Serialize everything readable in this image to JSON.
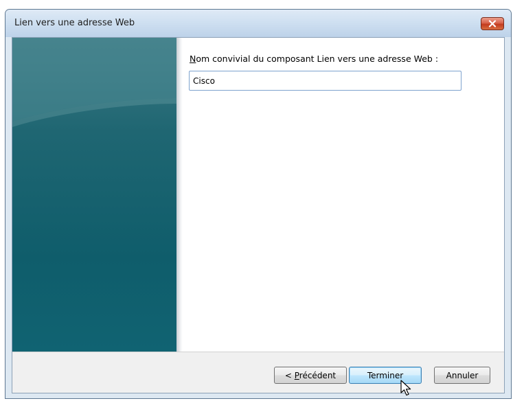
{
  "window": {
    "title": "Lien vers une adresse Web",
    "close_icon": "close-icon"
  },
  "form": {
    "label_mnemonic": "N",
    "label_rest": "om convivial du composant Lien vers une adresse Web :",
    "input_value": "Cisco"
  },
  "buttons": {
    "prev_prefix": "< ",
    "prev_mnemonic": "P",
    "prev_rest": "récédent",
    "finish": "Terminer",
    "cancel": "Annuler"
  },
  "colors": {
    "side_panel": "#0f5d6b",
    "title_bar": "#cfe0f1",
    "close_button": "#c23b1f",
    "default_button_border": "#3c7fb1"
  }
}
